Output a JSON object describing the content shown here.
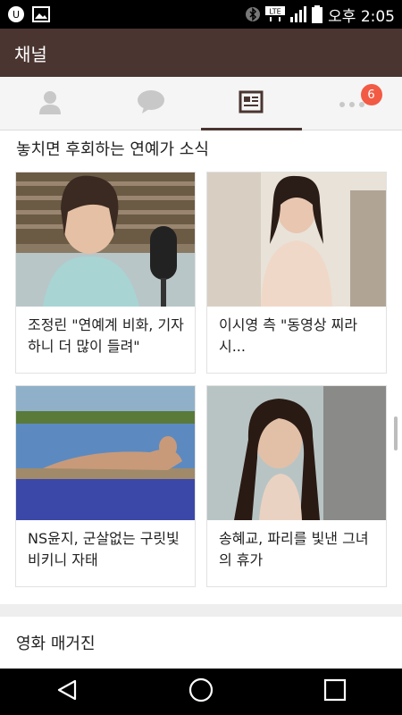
{
  "status_bar": {
    "time": "오후 2:05",
    "lte_label": "LTE",
    "icons": [
      "camera-icon",
      "image-icon",
      "bluetooth-icon",
      "lte-icon",
      "signal-icon",
      "battery-icon"
    ]
  },
  "app_bar": {
    "title": "채널"
  },
  "tabs": [
    {
      "name": "friends",
      "icon": "person-icon",
      "active": false
    },
    {
      "name": "chats",
      "icon": "chat-bubble-icon",
      "active": false
    },
    {
      "name": "channel",
      "icon": "news-icon",
      "active": true
    },
    {
      "name": "more",
      "icon": "more-dots-icon",
      "active": false,
      "badge": "6"
    }
  ],
  "section": {
    "title": "놓치면 후회하는 연예가 소식",
    "cards": [
      {
        "title": "조정린 \"연예계 비화, 기자하니 더 많이 들려\"",
        "thumb": "radio-studio-photo"
      },
      {
        "title": "이시영 측 \"동영상 찌라시...",
        "thumb": "event-photo"
      },
      {
        "title": "NS윤지, 군살없는 구릿빛 비키니 자태",
        "thumb": "pool-photo"
      },
      {
        "title": "송혜교, 파리를 빛낸 그녀의 휴가",
        "thumb": "portrait-photo"
      }
    ]
  },
  "section2": {
    "title": "영화 매거진"
  },
  "nav": {
    "icons": [
      "back-icon",
      "home-icon",
      "recents-icon"
    ]
  },
  "colors": {
    "app_bar": "#4a3530",
    "badge": "#f25a44"
  }
}
